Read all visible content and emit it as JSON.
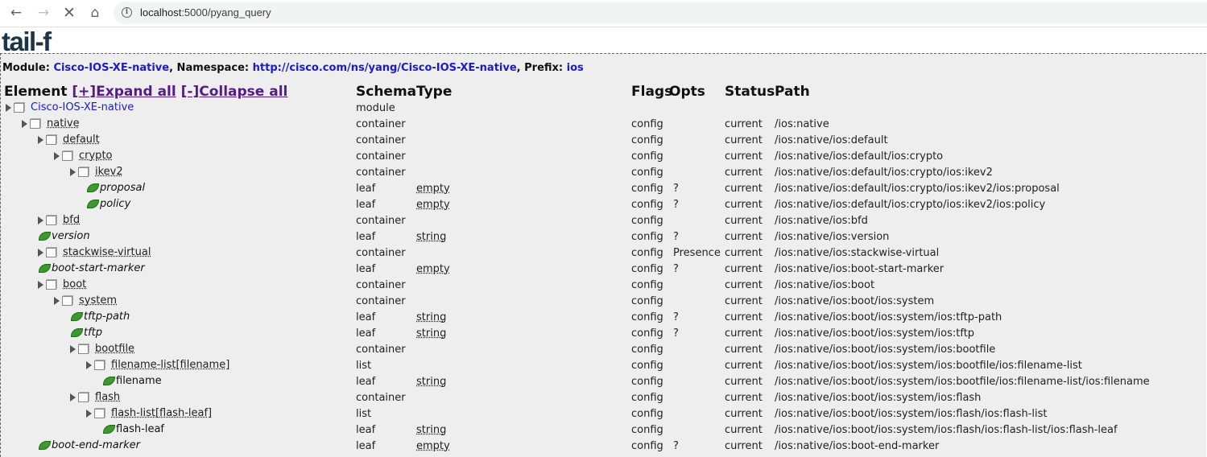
{
  "browser": {
    "url_host": "localhost",
    "url_rest": ":5000/pyang_query"
  },
  "logo": "tail-f",
  "module_line": {
    "module_label": "Module: ",
    "module": "Cisco-IOS-XE-native",
    "namespace_label": ", Namespace: ",
    "namespace": "http://cisco.com/ns/yang/Cisco-IOS-XE-native",
    "prefix_label": ", Prefix: ",
    "prefix": "ios"
  },
  "headers": {
    "element": "Element",
    "expand_all": "[+]Expand all",
    "collapse_all": "[-]Collapse all",
    "schema": "Schema",
    "type": "Type",
    "flags": "Flags",
    "opts": "Opts",
    "status": "Status",
    "path": "Path"
  },
  "rows": [
    {
      "name": "Cisco-IOS-XE-native",
      "kind": "module",
      "level": 0,
      "schema": "module",
      "type": "",
      "flags": "",
      "opts": "",
      "status": "",
      "path": ""
    },
    {
      "name": "native",
      "kind": "node",
      "level": 1,
      "schema": "container",
      "type": "",
      "flags": "config",
      "opts": "",
      "status": "current",
      "path": "/ios:native"
    },
    {
      "name": "default",
      "kind": "node",
      "level": 2,
      "schema": "container",
      "type": "",
      "flags": "config",
      "opts": "",
      "status": "current",
      "path": "/ios:native/ios:default"
    },
    {
      "name": "crypto",
      "kind": "node",
      "level": 3,
      "schema": "container",
      "type": "",
      "flags": "config",
      "opts": "",
      "status": "current",
      "path": "/ios:native/ios:default/ios:crypto"
    },
    {
      "name": "ikev2",
      "kind": "node",
      "level": 4,
      "schema": "container",
      "type": "",
      "flags": "config",
      "opts": "",
      "status": "current",
      "path": "/ios:native/ios:default/ios:crypto/ios:ikev2"
    },
    {
      "name": "proposal",
      "kind": "leaf-opt",
      "level": 5,
      "schema": "leaf",
      "type": "empty",
      "flags": "config",
      "opts": "?",
      "status": "current",
      "path": "/ios:native/ios:default/ios:crypto/ios:ikev2/ios:proposal"
    },
    {
      "name": "policy",
      "kind": "leaf-opt",
      "level": 5,
      "schema": "leaf",
      "type": "empty",
      "flags": "config",
      "opts": "?",
      "status": "current",
      "path": "/ios:native/ios:default/ios:crypto/ios:ikev2/ios:policy"
    },
    {
      "name": "bfd",
      "kind": "node",
      "level": 2,
      "schema": "container",
      "type": "",
      "flags": "config",
      "opts": "",
      "status": "current",
      "path": "/ios:native/ios:bfd"
    },
    {
      "name": "version",
      "kind": "leaf-opt",
      "level": 2,
      "schema": "leaf",
      "type": "string",
      "flags": "config",
      "opts": "?",
      "status": "current",
      "path": "/ios:native/ios:version"
    },
    {
      "name": "stackwise-virtual",
      "kind": "node",
      "level": 2,
      "schema": "container",
      "type": "",
      "flags": "config",
      "opts": "Presence",
      "status": "current",
      "path": "/ios:native/ios:stackwise-virtual"
    },
    {
      "name": "boot-start-marker",
      "kind": "leaf-opt",
      "level": 2,
      "schema": "leaf",
      "type": "empty",
      "flags": "config",
      "opts": "?",
      "status": "current",
      "path": "/ios:native/ios:boot-start-marker"
    },
    {
      "name": "boot",
      "kind": "node",
      "level": 2,
      "schema": "container",
      "type": "",
      "flags": "config",
      "opts": "",
      "status": "current",
      "path": "/ios:native/ios:boot"
    },
    {
      "name": "system",
      "kind": "node",
      "level": 3,
      "schema": "container",
      "type": "",
      "flags": "config",
      "opts": "",
      "status": "current",
      "path": "/ios:native/ios:boot/ios:system"
    },
    {
      "name": "tftp-path",
      "kind": "leaf-opt",
      "level": 4,
      "schema": "leaf",
      "type": "string",
      "flags": "config",
      "opts": "?",
      "status": "current",
      "path": "/ios:native/ios:boot/ios:system/ios:tftp-path"
    },
    {
      "name": "tftp",
      "kind": "leaf-opt",
      "level": 4,
      "schema": "leaf",
      "type": "string",
      "flags": "config",
      "opts": "?",
      "status": "current",
      "path": "/ios:native/ios:boot/ios:system/ios:tftp"
    },
    {
      "name": "bootfile",
      "kind": "node",
      "level": 4,
      "schema": "container",
      "type": "",
      "flags": "config",
      "opts": "",
      "status": "current",
      "path": "/ios:native/ios:boot/ios:system/ios:bootfile"
    },
    {
      "name": "filename-list[filename]",
      "kind": "node",
      "level": 5,
      "schema": "list",
      "type": "",
      "flags": "config",
      "opts": "",
      "status": "current",
      "path": "/ios:native/ios:boot/ios:system/ios:bootfile/ios:filename-list"
    },
    {
      "name": "filename",
      "kind": "leaf-key",
      "level": 6,
      "schema": "leaf",
      "type": "string",
      "flags": "config",
      "opts": "",
      "status": "current",
      "path": "/ios:native/ios:boot/ios:system/ios:bootfile/ios:filename-list/ios:filename"
    },
    {
      "name": "flash",
      "kind": "node",
      "level": 4,
      "schema": "container",
      "type": "",
      "flags": "config",
      "opts": "",
      "status": "current",
      "path": "/ios:native/ios:boot/ios:system/ios:flash"
    },
    {
      "name": "flash-list[flash-leaf]",
      "kind": "node",
      "level": 5,
      "schema": "list",
      "type": "",
      "flags": "config",
      "opts": "",
      "status": "current",
      "path": "/ios:native/ios:boot/ios:system/ios:flash/ios:flash-list"
    },
    {
      "name": "flash-leaf",
      "kind": "leaf-key",
      "level": 6,
      "schema": "leaf",
      "type": "string",
      "flags": "config",
      "opts": "",
      "status": "current",
      "path": "/ios:native/ios:boot/ios:system/ios:flash/ios:flash-list/ios:flash-leaf"
    },
    {
      "name": "boot-end-marker",
      "kind": "leaf-opt",
      "level": 2,
      "schema": "leaf",
      "type": "empty",
      "flags": "config",
      "opts": "?",
      "status": "current",
      "path": "/ios:native/ios:boot-end-marker"
    }
  ]
}
